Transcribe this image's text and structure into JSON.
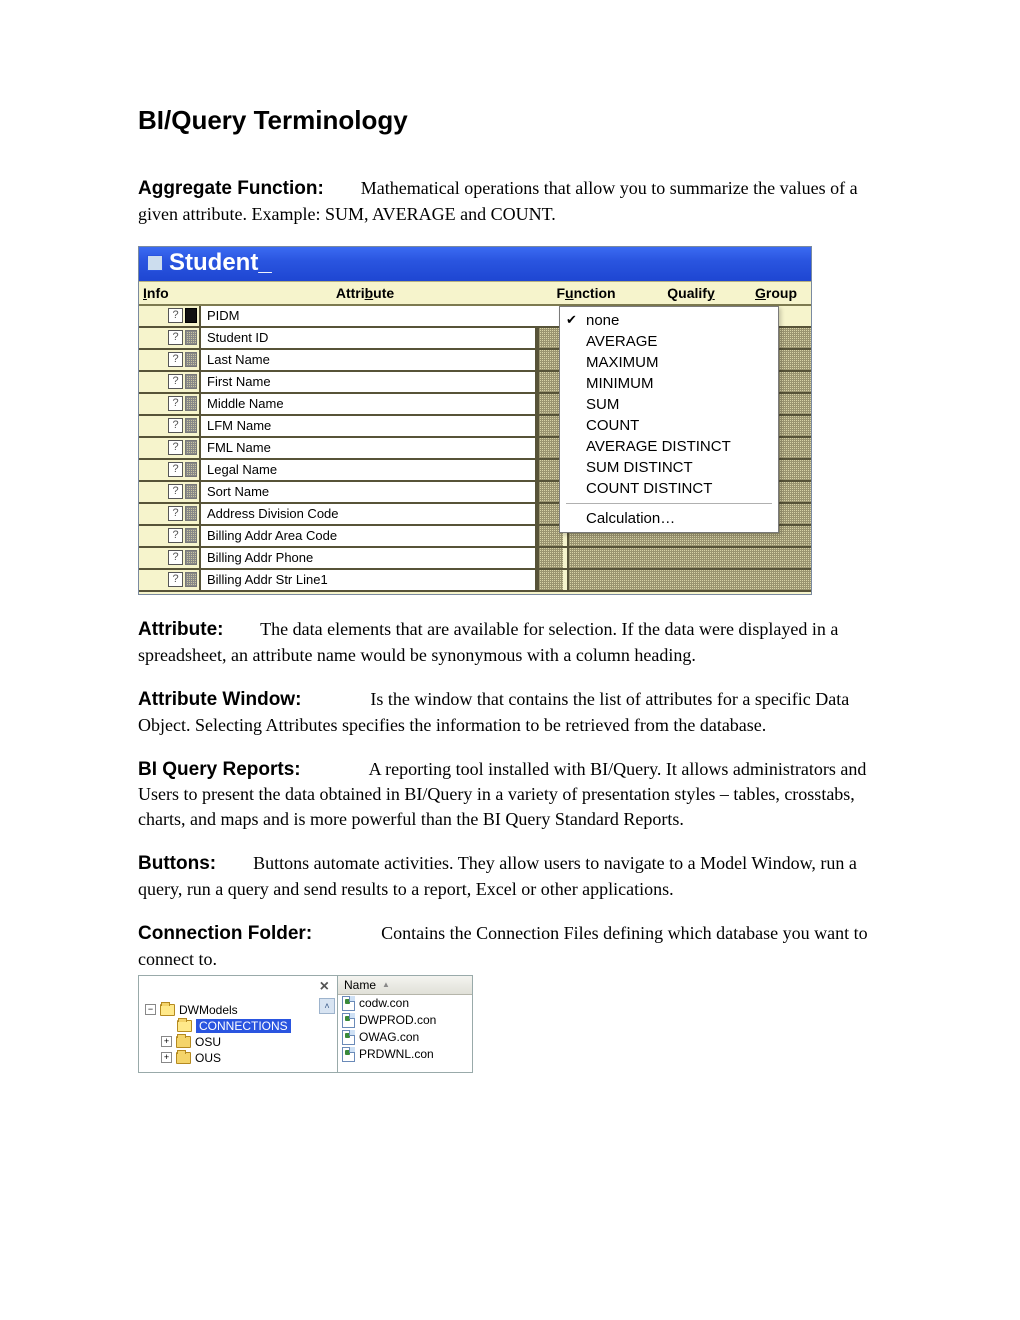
{
  "title": "BI/Query Terminology",
  "terms": {
    "aggregate": {
      "label": "Aggregate Function:",
      "text": "Mathematical operations that allow you to summarize the values of a given attribute. Example: SUM, AVERAGE and COUNT."
    },
    "attribute": {
      "label": "Attribute:",
      "text": "The data elements that are available for selection.  If the data were displayed in a spreadsheet, an attribute name would be synonymous with a column heading."
    },
    "attr_window": {
      "label": "Attribute Window:",
      "text": "Is the window that contains the list of attributes for a specific Data Object.  Selecting Attributes specifies the information to be retrieved from the database."
    },
    "bi_query_reports": {
      "label": "BI Query Reports:",
      "text": "A reporting tool installed with BI/Query. It allows administrators and Users to present the data obtained in BI/Query in a variety of presentation styles – tables, crosstabs, charts, and maps and is more powerful than the BI Query Standard Reports."
    },
    "buttons": {
      "label": "Buttons:",
      "text": "Buttons automate activities.  They allow users to navigate to a Model Window, run a query, run a query and send results to a report, Excel or other applications."
    },
    "connection_folder": {
      "label": "Connection Folder:",
      "text": "Contains the Connection Files defining which database you want to connect to."
    }
  },
  "student_window": {
    "title": "Student_",
    "headers": {
      "info": "Info",
      "attribute": "Attribute",
      "function": "Function",
      "qualify": "Qualify",
      "group": "Group"
    },
    "attributes": [
      "PIDM",
      "Student ID",
      "Last Name",
      "First Name",
      "Middle Name",
      "LFM Name",
      "FML Name",
      "Legal Name",
      "Sort Name",
      "Address Division Code",
      "Billing Addr Area Code",
      "Billing Addr Phone",
      "Billing Addr Str Line1"
    ],
    "function_menu": [
      "none",
      "AVERAGE",
      "MAXIMUM",
      "MINIMUM",
      "SUM",
      "COUNT",
      "AVERAGE DISTINCT",
      "SUM DISTINCT",
      "COUNT DISTINCT"
    ],
    "function_menu_selected": "none",
    "function_menu_calc": "Calculation…"
  },
  "explorer": {
    "list_header": "Name",
    "tree": [
      {
        "label": "DWModels",
        "level": 0,
        "expander": "−",
        "open": true,
        "selected": false
      },
      {
        "label": "CONNECTIONS",
        "level": 1,
        "expander": "",
        "open": true,
        "selected": true
      },
      {
        "label": "OSU",
        "level": 1,
        "expander": "+",
        "open": false,
        "selected": false
      },
      {
        "label": "OUS",
        "level": 1,
        "expander": "+",
        "open": false,
        "selected": false
      }
    ],
    "files": [
      "codw.con",
      "DWPROD.con",
      "OWAG.con",
      "PRDWNL.con"
    ]
  }
}
